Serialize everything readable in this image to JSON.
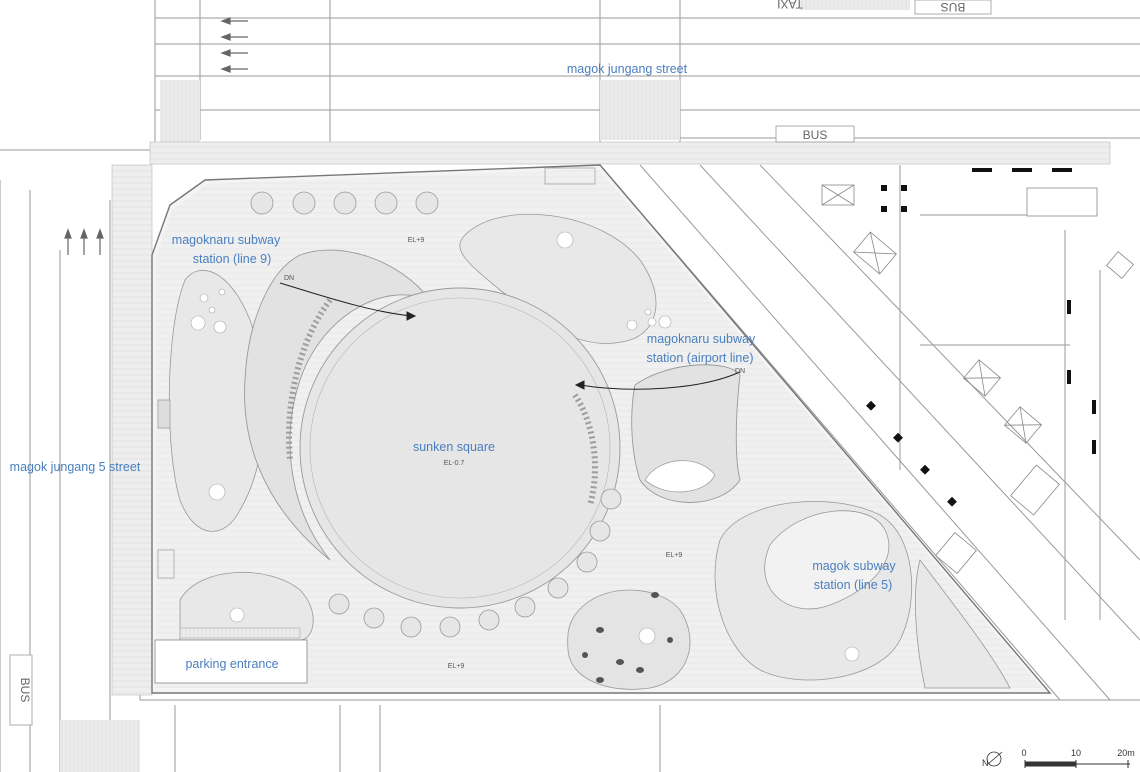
{
  "streets": {
    "north": "magok jungang street",
    "west": "magok jungang 5 street"
  },
  "stations": {
    "line9_a": "magoknaru subway",
    "line9_b": "station (line 9)",
    "airport_a": "magoknaru subway",
    "airport_b": "station (airport line)",
    "line5_a": "magok subway",
    "line5_b": "station (line 5)"
  },
  "square": {
    "name": "sunken square",
    "elevation": "EL-0.7"
  },
  "elevations": {
    "north": "EL+9",
    "east": "EL+9",
    "south": "EL+9"
  },
  "stairs": {
    "down": "DN"
  },
  "parking": "parking entrance",
  "road_marks": {
    "bus_top": "BUS",
    "bus_north": "BUS",
    "bus_west": "BUS",
    "taxi": "TAXI"
  },
  "scale": {
    "ticks": [
      "0",
      "10",
      "20m"
    ],
    "north": "N"
  },
  "colors": {
    "label": "#4a7fbf",
    "line": "#8a8a8a",
    "fill": "#e6e6e6"
  }
}
